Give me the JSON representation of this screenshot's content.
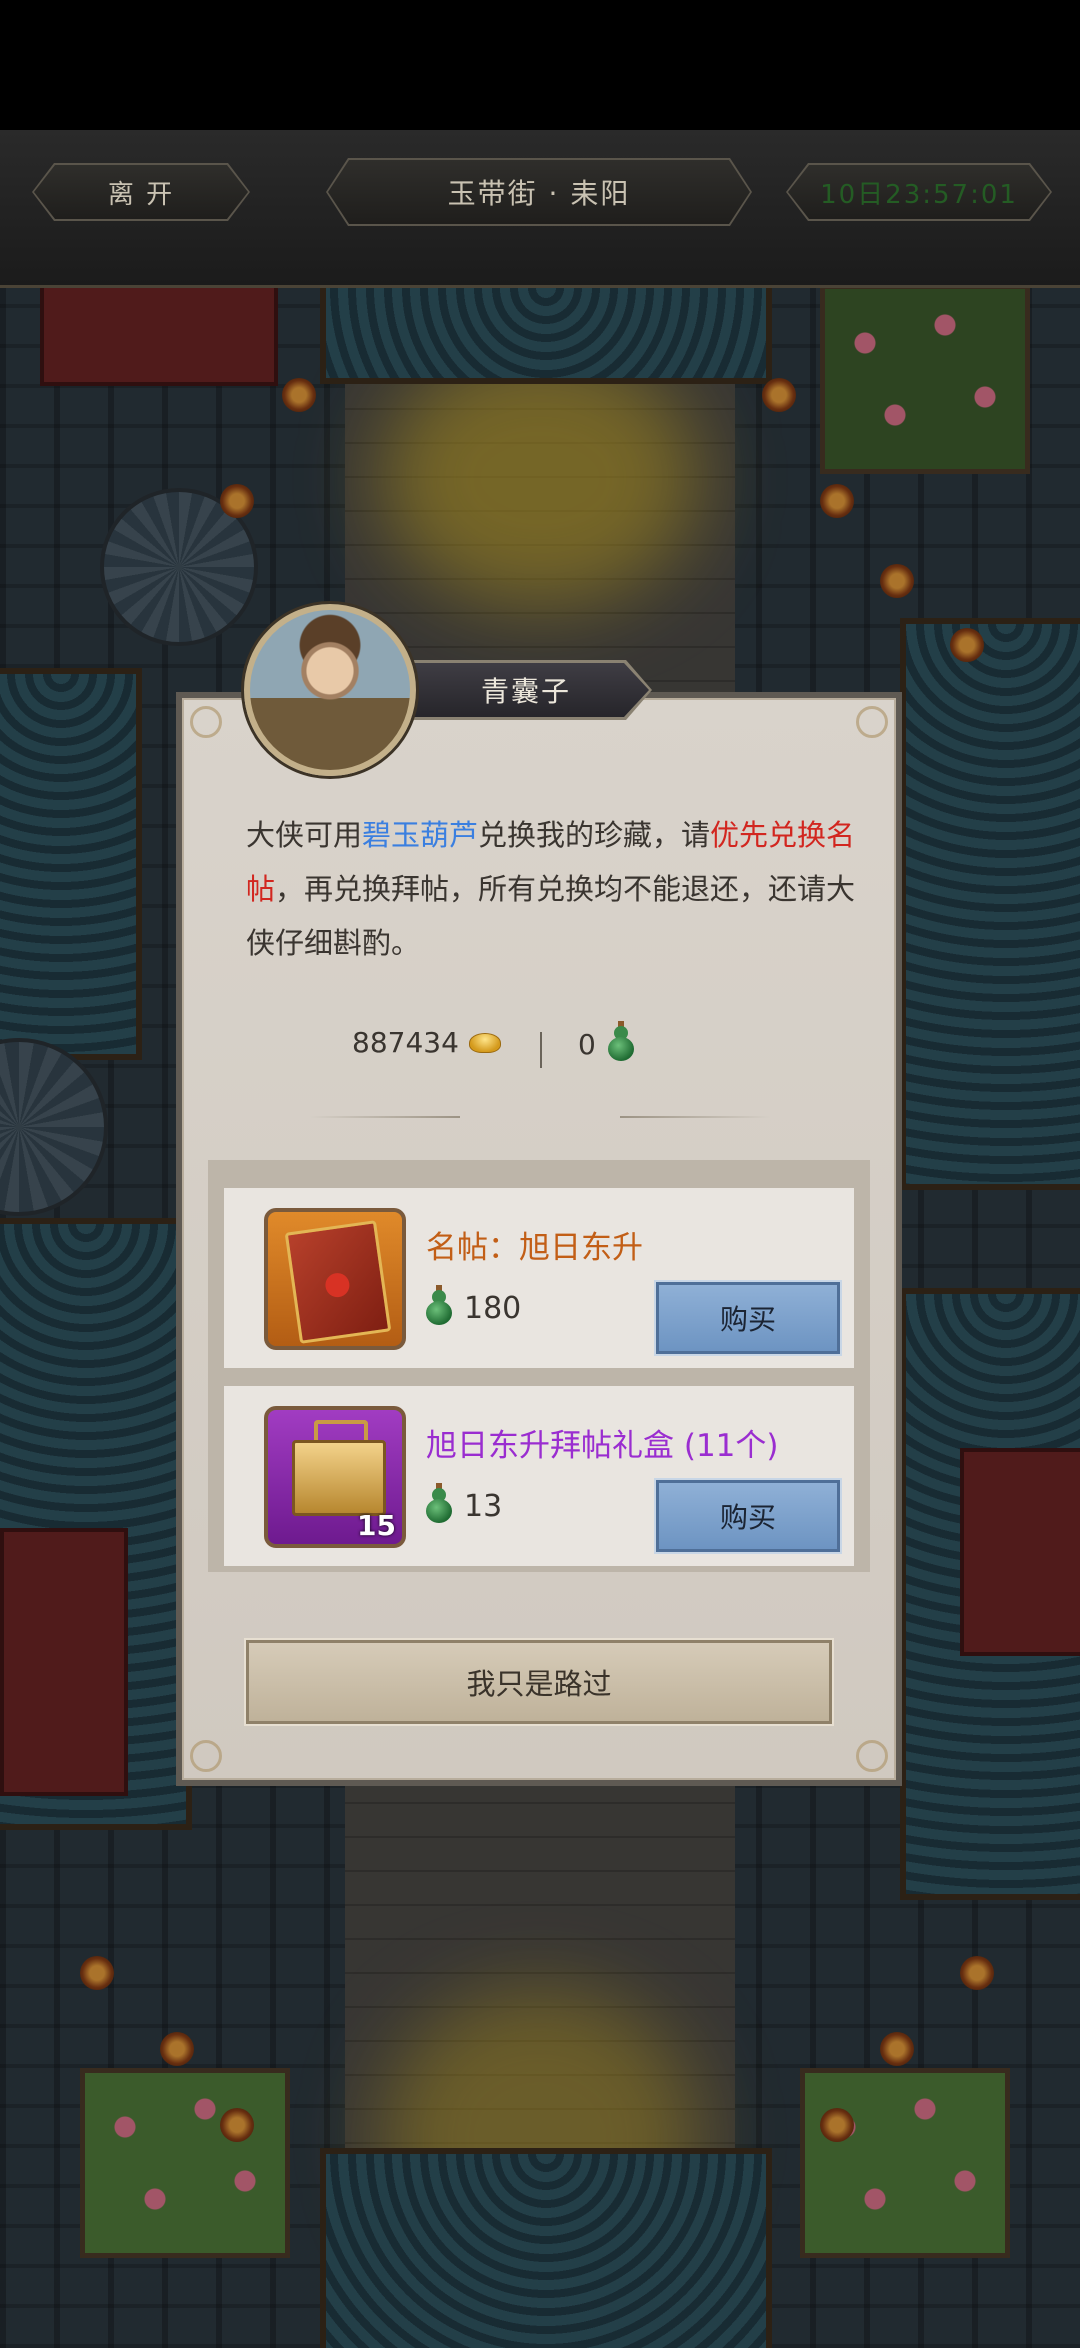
{
  "header": {
    "leave_label": "离 开",
    "location": "玉带街 · 耒阳",
    "timer": "10日23:57:01"
  },
  "npc": {
    "name": "青囊子",
    "description": {
      "part1": "大侠可用",
      "item_blue": "碧玉葫芦",
      "part2": "兑换我的珍藏，请",
      "item_red": "优先兑换名帖",
      "part3": "，再兑换拜帖，所有兑换均不能退还，还请大侠仔细斟酌。"
    }
  },
  "currency": {
    "gold_amount": "887434",
    "gold_icon": "gold-ingot-icon",
    "gourd_amount": "0",
    "gourd_icon": "jade-gourd-icon"
  },
  "shop_items": [
    {
      "name": "名帖：旭日东升",
      "price": "180",
      "buy_label": "购买",
      "icon": "book-icon",
      "frame_color": "#e08a2a",
      "quantity_badge": ""
    },
    {
      "name": "旭日东升拜帖礼盒 (11个)",
      "price": "13",
      "buy_label": "购买",
      "icon": "chest-icon",
      "frame_color": "#a13cc2",
      "quantity_badge": "15"
    }
  ],
  "footer": {
    "pass_label": "我只是路过"
  },
  "colors": {
    "highlight_blue": "#3a7fe0",
    "highlight_red": "#d2261f",
    "item1_name": "#c25e16",
    "item2_name": "#9a2dd0",
    "buy_button": "#7ea2cc",
    "timer_text": "#245c24"
  }
}
